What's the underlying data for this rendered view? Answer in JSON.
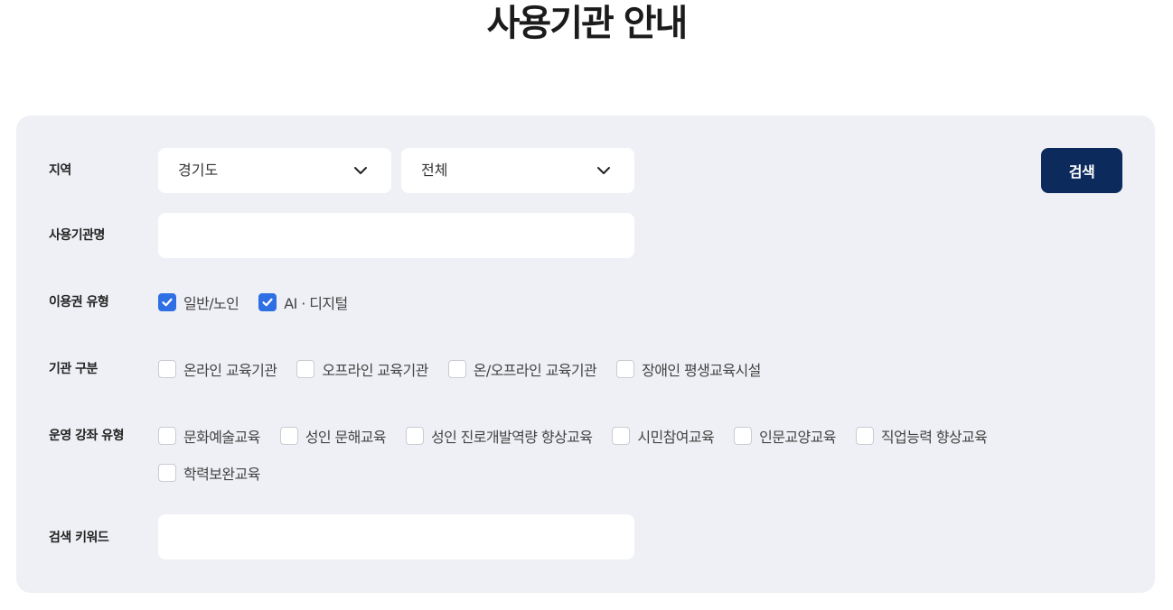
{
  "page": {
    "title": "사용기관 안내"
  },
  "filters": {
    "region": {
      "label": "지역",
      "province_value": "경기도",
      "district_value": "전체"
    },
    "institution_name": {
      "label": "사용기관명",
      "value": "",
      "placeholder": ""
    },
    "voucher_type": {
      "label": "이용권 유형",
      "options": [
        {
          "label": "일반/노인",
          "checked": true
        },
        {
          "label": "AI · 디지털",
          "checked": true
        }
      ]
    },
    "institution_category": {
      "label": "기관 구분",
      "options": [
        {
          "label": "온라인 교육기관",
          "checked": false
        },
        {
          "label": "오프라인 교육기관",
          "checked": false
        },
        {
          "label": "온/오프라인 교육기관",
          "checked": false
        },
        {
          "label": "장애인 평생교육시설",
          "checked": false
        }
      ]
    },
    "course_type": {
      "label": "운영 강좌 유형",
      "options": [
        {
          "label": "문화예술교육",
          "checked": false
        },
        {
          "label": "성인 문해교육",
          "checked": false
        },
        {
          "label": "성인 진로개발역량 향상교육",
          "checked": false
        },
        {
          "label": "시민참여교육",
          "checked": false
        },
        {
          "label": "인문교양교육",
          "checked": false
        },
        {
          "label": "직업능력 향상교육",
          "checked": false
        },
        {
          "label": "학력보완교육",
          "checked": false
        }
      ]
    },
    "keyword": {
      "label": "검색 키워드",
      "value": "",
      "placeholder": ""
    }
  },
  "actions": {
    "search_label": "검색"
  },
  "colors": {
    "accent": "#0d2a5c",
    "checkbox_checked": "#2f6fe4",
    "panel_bg": "#eef0f5"
  }
}
